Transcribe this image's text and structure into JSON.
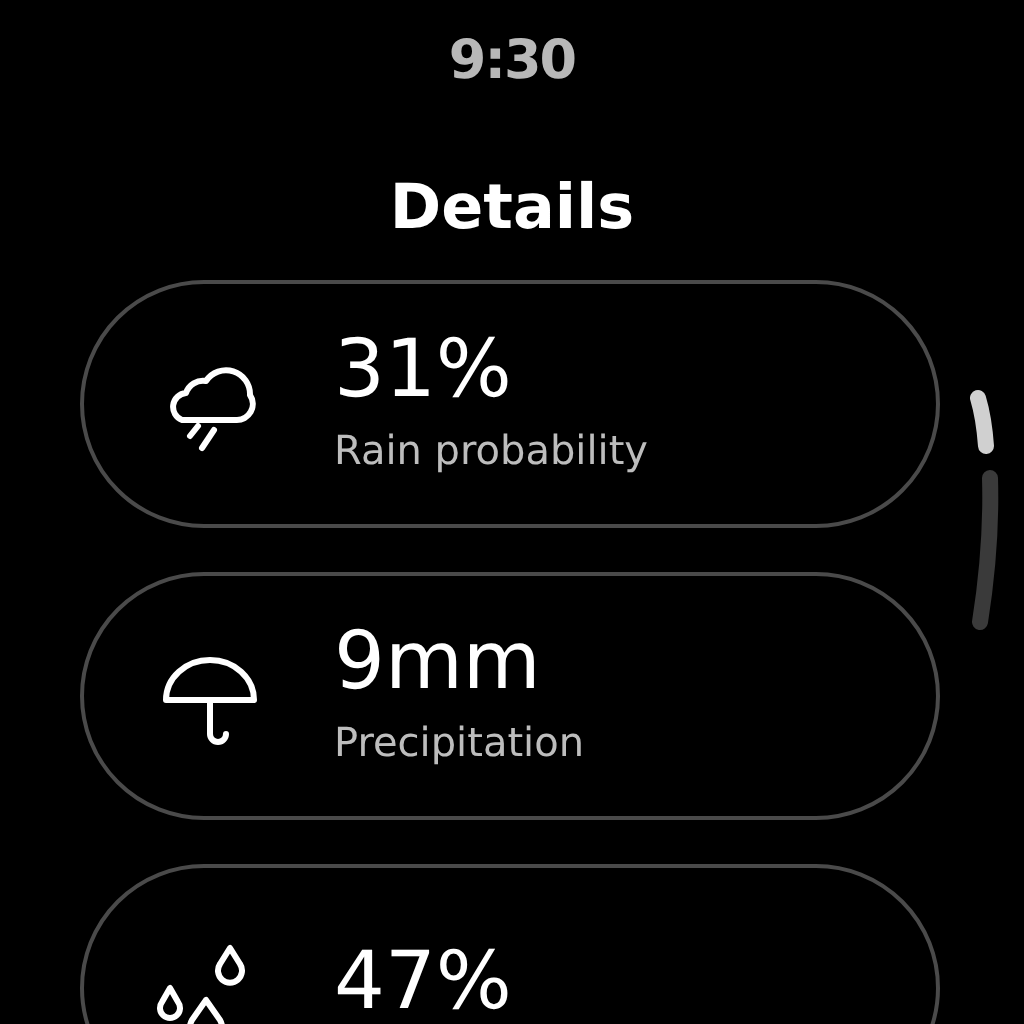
{
  "status_bar": {
    "time": "9:30"
  },
  "title": "Details",
  "cards": [
    {
      "value": "31%",
      "label": "Rain probability"
    },
    {
      "value": "9mm",
      "label": "Precipitation"
    },
    {
      "value": "47%"
    }
  ]
}
